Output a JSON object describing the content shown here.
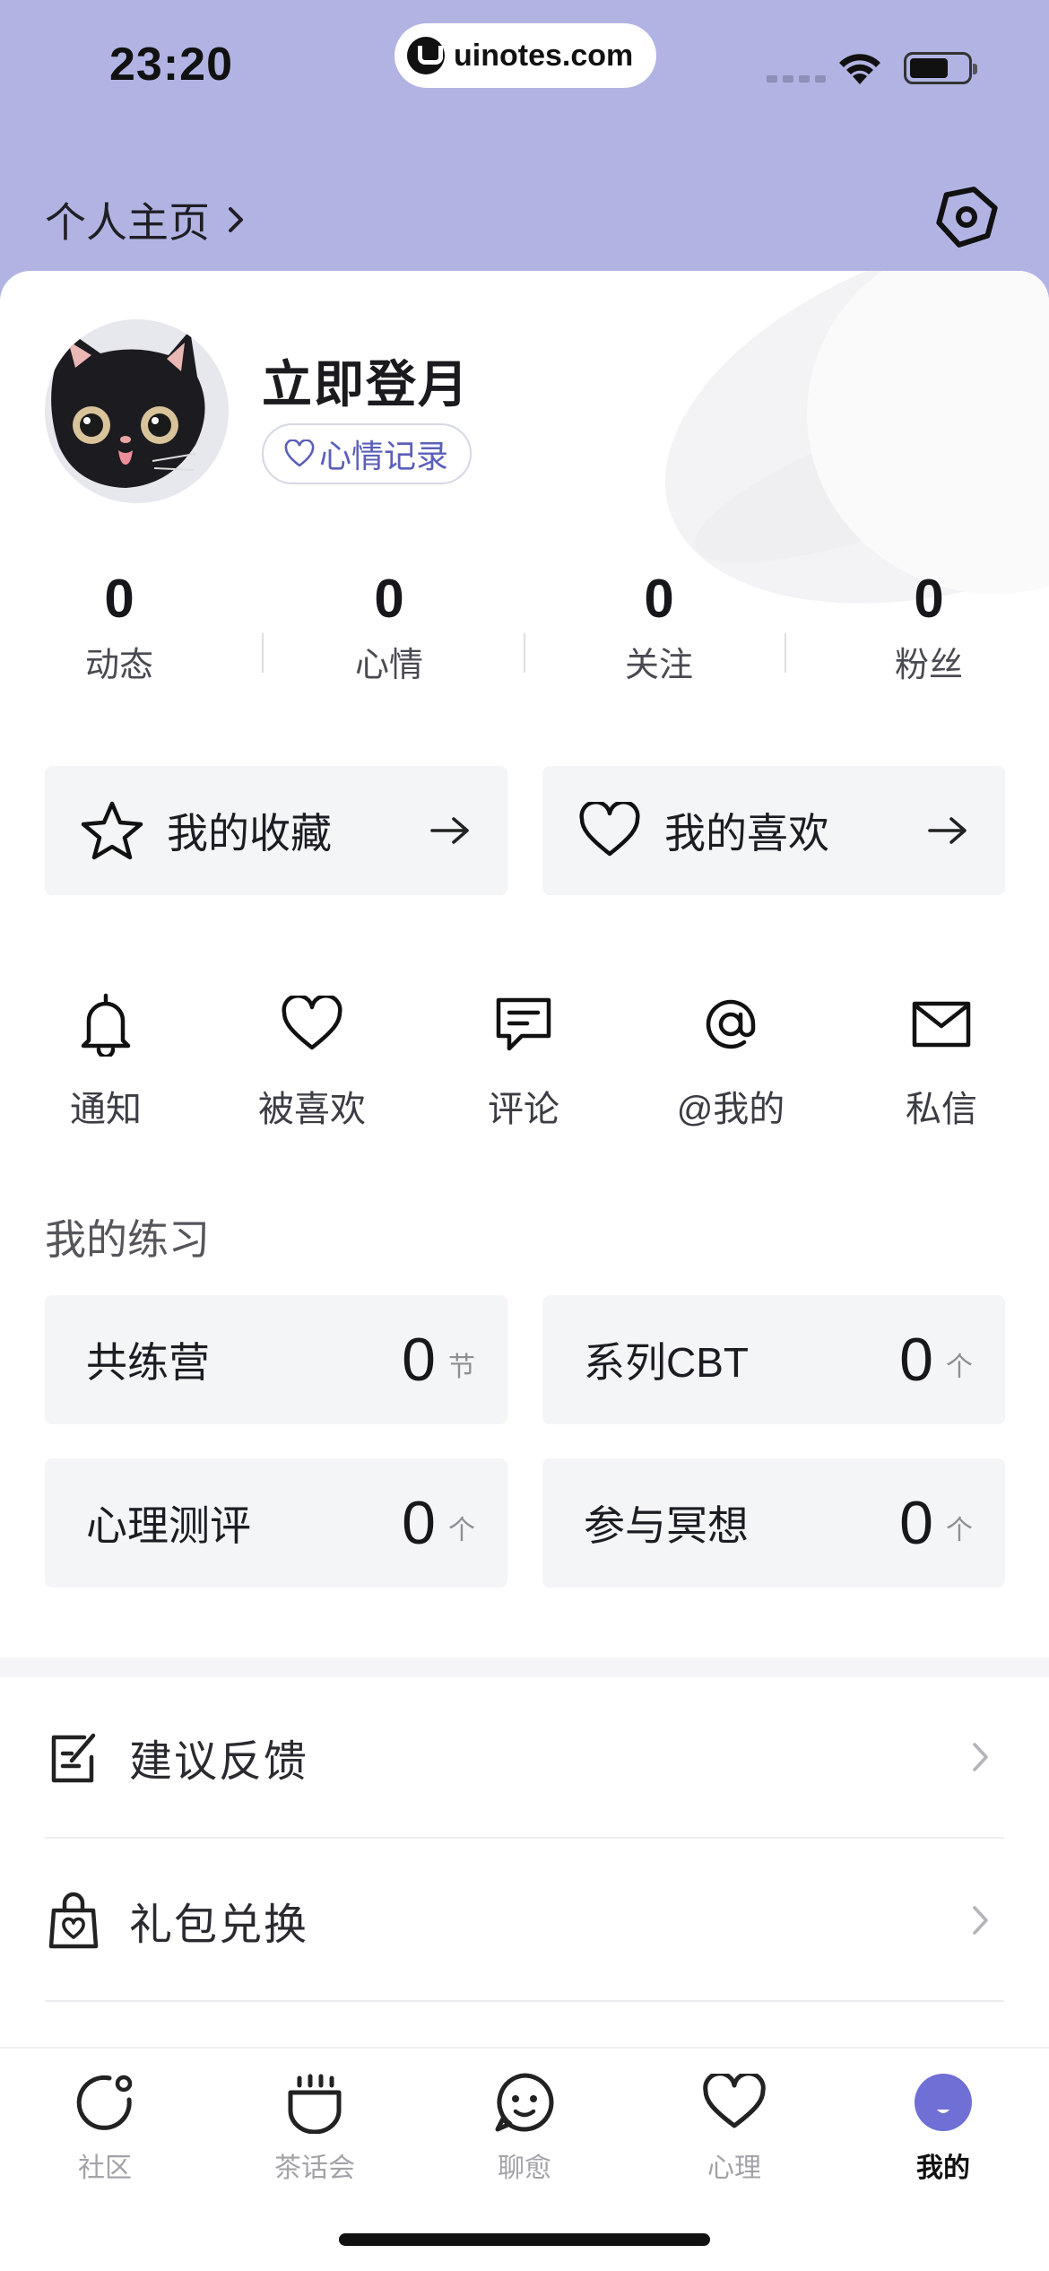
{
  "status_bar": {
    "time": "23:20",
    "url": "uinotes.com"
  },
  "header": {
    "homepage_link": "个人主页",
    "settings_icon": "hexagon-settings-icon"
  },
  "profile": {
    "username": "立即登月",
    "mood_chip": "心情记录",
    "avatar_icon": "black-cat-avatar"
  },
  "stats": [
    {
      "value": "0",
      "label": "动态"
    },
    {
      "value": "0",
      "label": "心情"
    },
    {
      "value": "0",
      "label": "关注"
    },
    {
      "value": "0",
      "label": "粉丝"
    }
  ],
  "collections": [
    {
      "label": "我的收藏",
      "icon": "star-icon"
    },
    {
      "label": "我的喜欢",
      "icon": "heart-icon"
    }
  ],
  "quick_actions": [
    {
      "label": "通知",
      "icon": "bell-icon"
    },
    {
      "label": "被喜欢",
      "icon": "heart-icon"
    },
    {
      "label": "评论",
      "icon": "comment-icon"
    },
    {
      "label": "@我的",
      "icon": "at-icon"
    },
    {
      "label": "私信",
      "icon": "mail-icon"
    }
  ],
  "practice": {
    "title": "我的练习",
    "items": [
      {
        "label": "共练营",
        "value": "0",
        "unit": "节"
      },
      {
        "label": "系列CBT",
        "value": "0",
        "unit": "个"
      },
      {
        "label": "心理测评",
        "value": "0",
        "unit": "个"
      },
      {
        "label": "参与冥想",
        "value": "0",
        "unit": "个"
      }
    ]
  },
  "menu": [
    {
      "label": "建议反馈",
      "icon": "feedback-icon"
    },
    {
      "label": "礼包兑换",
      "icon": "gift-bag-icon"
    }
  ],
  "tabbar": [
    {
      "label": "社区",
      "icon": "community-icon",
      "active": false
    },
    {
      "label": "茶话会",
      "icon": "tea-party-icon",
      "active": false
    },
    {
      "label": "聊愈",
      "icon": "smile-chat-icon",
      "active": false
    },
    {
      "label": "心理",
      "icon": "heart-icon",
      "active": false
    },
    {
      "label": "我的",
      "icon": "profile-icon",
      "active": true
    }
  ],
  "colors": {
    "header_bg": "#b1b4e3",
    "accent": "#6f6fd6",
    "card_bg": "#f4f5f7"
  }
}
